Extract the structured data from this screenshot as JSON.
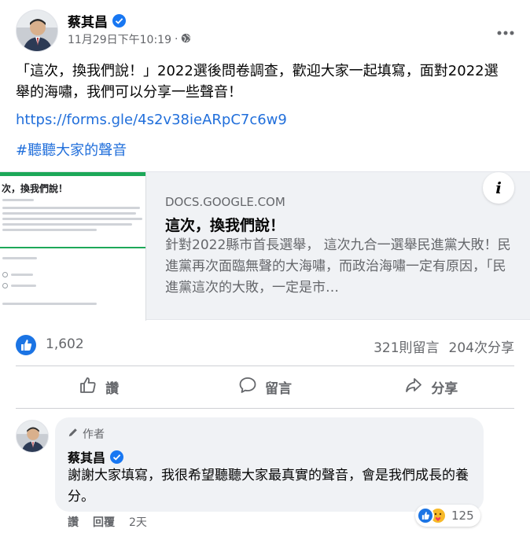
{
  "post": {
    "author": "蔡其昌",
    "timestamp": "11月29日下午10:19",
    "separator": "·",
    "more_icon": "more-horizontal-icon",
    "text": "「這次，換我們說！」2022選後問卷調查，歡迎大家一起填寫，面對2022選舉的海嘯，我們可以分享一些聲音！",
    "link": "https://forms.gle/4s2v38ieARpC7c6w9",
    "hashtag": "#聽聽大家的聲音"
  },
  "link_card": {
    "thumbnail_title": "次，換我們說！",
    "domain": "DOCS.GOOGLE.COM",
    "title": "這次，換我們說！",
    "description": "針對2022縣市首長選舉， 這次九合一選舉民進黨大敗！民進黨再次面臨無聲的大海嘯，而政治海嘯一定有原因，「民進黨這次的大敗，一定是市…",
    "info_label": "i"
  },
  "stats": {
    "likes": "1,602",
    "comments": "321則留言",
    "shares": "204次分享"
  },
  "actions": {
    "like": "讚",
    "comment": "留言",
    "share": "分享"
  },
  "comment": {
    "badge": "作者",
    "author": "蔡其昌",
    "text": "謝謝大家填寫，我很希望聽聽大家最真實的聲音，會是我們成長的養分。",
    "like_action": "讚",
    "reply_action": "回覆",
    "age": "2天",
    "reaction_count": "125"
  },
  "colors": {
    "link": "#216fdb",
    "verified": "#1877f2",
    "like_blue": "#1b74e4",
    "secondary_text": "#65676b",
    "card_bg": "#f0f2f5"
  }
}
